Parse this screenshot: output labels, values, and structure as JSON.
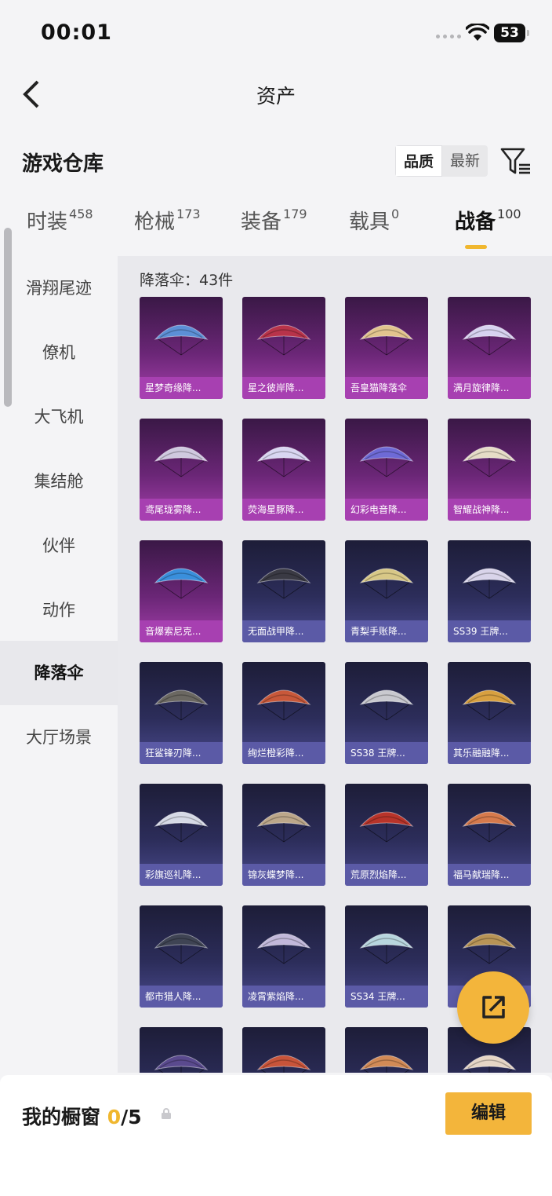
{
  "status_bar": {
    "time": "00:01",
    "battery": "53"
  },
  "nav": {
    "title": "资产"
  },
  "header": {
    "title": "游戏仓库",
    "sort_options": [
      "品质",
      "最新"
    ]
  },
  "category_tabs": [
    {
      "label": "时装",
      "count": "458"
    },
    {
      "label": "枪械",
      "count": "173"
    },
    {
      "label": "装备",
      "count": "179"
    },
    {
      "label": "载具",
      "count": "0"
    },
    {
      "label": "战备",
      "count": "100"
    }
  ],
  "sidebar": {
    "items": [
      "滑翔尾迹",
      "僚机",
      "大飞机",
      "集结舱",
      "伙伴",
      "动作",
      "降落伞",
      "大厅场景"
    ]
  },
  "content": {
    "count_label": "降落伞：43件",
    "items": [
      {
        "name": "星梦奇缘降...",
        "rarity": "purple",
        "color": "#5c8fd6"
      },
      {
        "name": "星之彼岸降...",
        "rarity": "purple",
        "color": "#b8334a"
      },
      {
        "name": "吾皇猫降落伞",
        "rarity": "purple",
        "color": "#e2c48e"
      },
      {
        "name": "满月旋律降...",
        "rarity": "purple",
        "color": "#d7d2f0"
      },
      {
        "name": "鸢尾珑雾降...",
        "rarity": "purple",
        "color": "#cfc9df"
      },
      {
        "name": "荧海星豚降...",
        "rarity": "purple",
        "color": "#d9d6f2"
      },
      {
        "name": "幻彩电音降...",
        "rarity": "purple",
        "color": "#6e6ad6"
      },
      {
        "name": "智耀战神降...",
        "rarity": "purple",
        "color": "#e6dcc7"
      },
      {
        "name": "音爆索尼克...",
        "rarity": "purple",
        "color": "#3a8fdc"
      },
      {
        "name": "无面战甲降...",
        "rarity": "blue",
        "color": "#3a3a44"
      },
      {
        "name": "青梨手账降...",
        "rarity": "blue",
        "color": "#d8c887"
      },
      {
        "name": "SS39 王牌...",
        "rarity": "blue",
        "color": "#d9d4ea"
      },
      {
        "name": "狂鲨锋刃降...",
        "rarity": "blue",
        "color": "#6b6862"
      },
      {
        "name": "绚烂橙彩降...",
        "rarity": "blue",
        "color": "#c8583a"
      },
      {
        "name": "SS38 王牌...",
        "rarity": "blue",
        "color": "#c9c9cf"
      },
      {
        "name": "其乐融融降...",
        "rarity": "blue",
        "color": "#d8a040"
      },
      {
        "name": "彩旗巡礼降...",
        "rarity": "blue",
        "color": "#d6dae6"
      },
      {
        "name": "锦灰蝶梦降...",
        "rarity": "blue",
        "color": "#bca78a"
      },
      {
        "name": "荒原烈焰降...",
        "rarity": "blue",
        "color": "#b8342a"
      },
      {
        "name": "福马献瑞降...",
        "rarity": "blue",
        "color": "#d67a4c"
      },
      {
        "name": "都市猎人降...",
        "rarity": "blue",
        "color": "#3f4454"
      },
      {
        "name": "凌霄紫焰降...",
        "rarity": "blue",
        "color": "#c2b8da"
      },
      {
        "name": "SS34 王牌...",
        "rarity": "blue",
        "color": "#b8d6de"
      },
      {
        "name": "",
        "rarity": "blue",
        "color": "#b89456"
      },
      {
        "name": "",
        "rarity": "blue",
        "color": "#5a4a8e"
      },
      {
        "name": "",
        "rarity": "blue",
        "color": "#c8543a"
      },
      {
        "name": "",
        "rarity": "blue",
        "color": "#d28a56"
      },
      {
        "name": "",
        "rarity": "blue",
        "color": "#e6d6c6"
      }
    ]
  },
  "bottom_bar": {
    "label": "我的橱窗",
    "count_current": "0",
    "count_total": "/5",
    "edit_label": "编辑"
  },
  "colors": {
    "accent": "#f0b72f",
    "purple_rarity": "#a740b1",
    "blue_rarity": "#5b5aa6"
  }
}
